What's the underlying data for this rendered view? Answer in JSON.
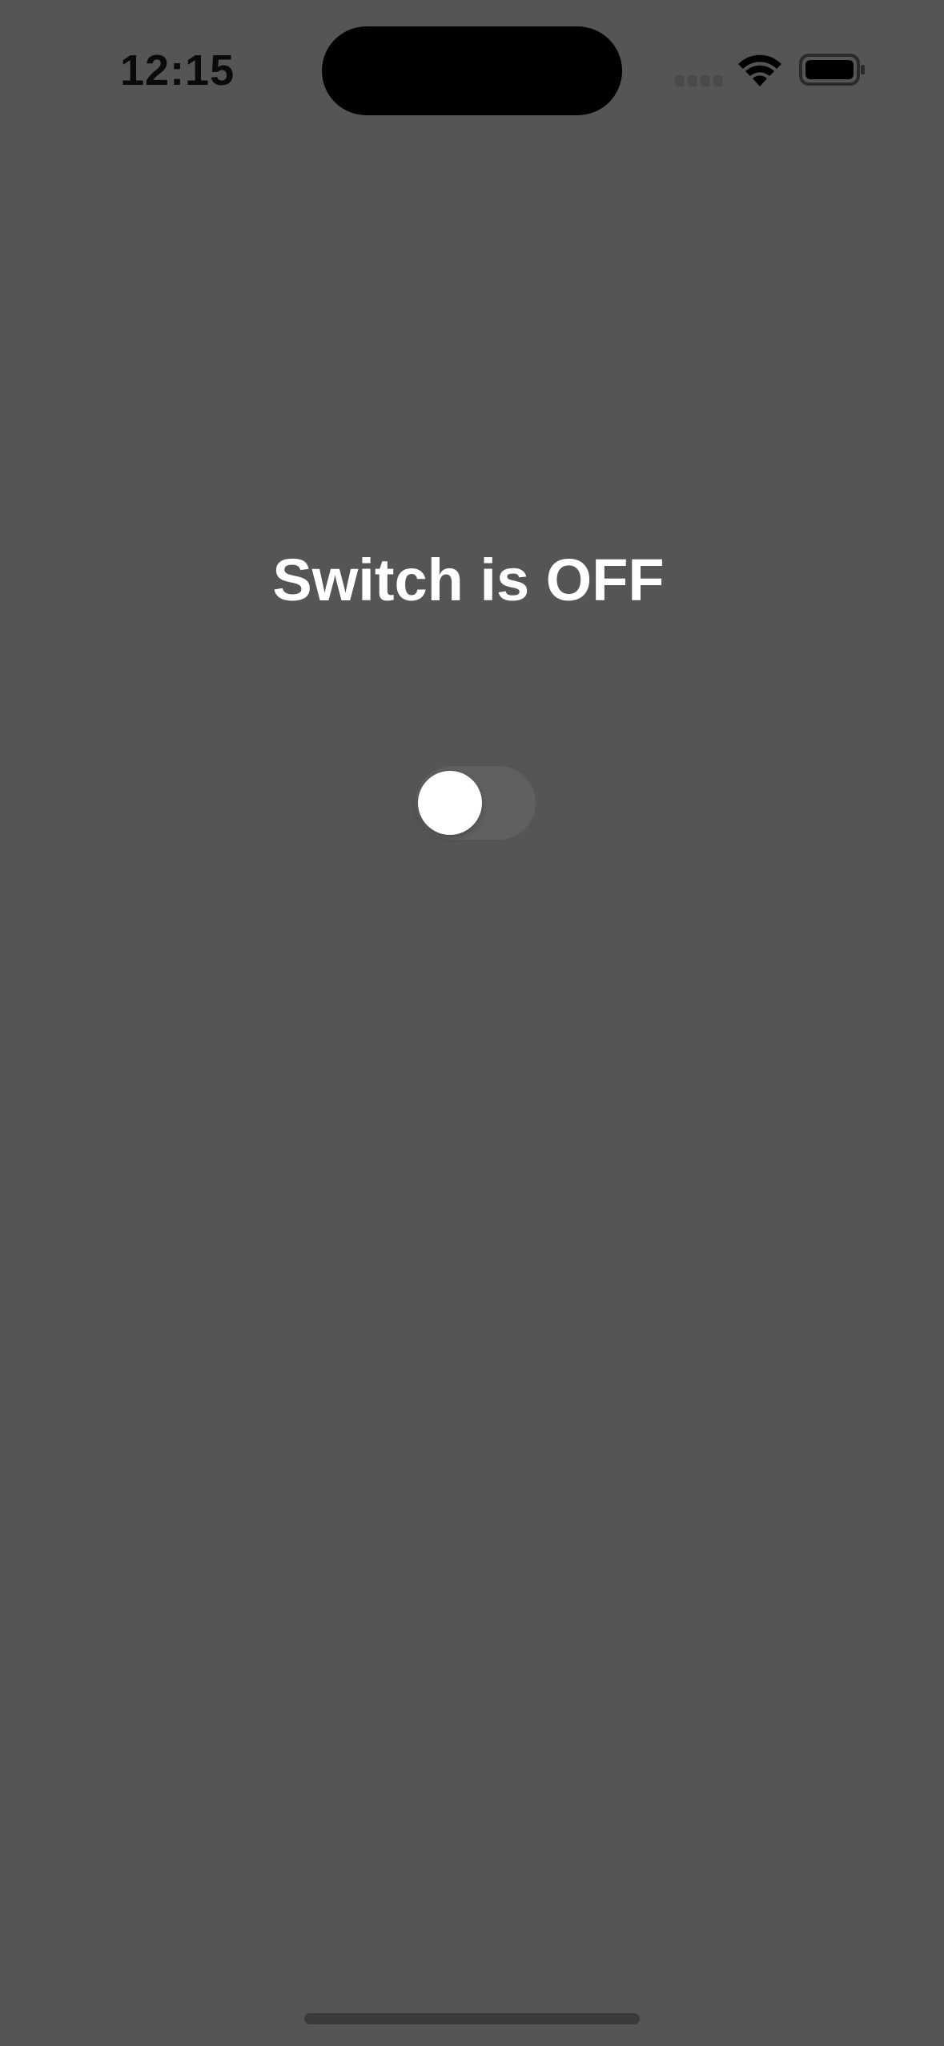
{
  "status_bar": {
    "time": "12:15",
    "icons": [
      "signal-dots-icon",
      "wifi-icon",
      "battery-icon"
    ]
  },
  "main": {
    "switch_label": "Switch is OFF",
    "switch_state": "off"
  },
  "colors": {
    "background": "#555555",
    "text": "#ffffff",
    "toggle_track_off": "#606060",
    "toggle_knob": "#ffffff"
  }
}
